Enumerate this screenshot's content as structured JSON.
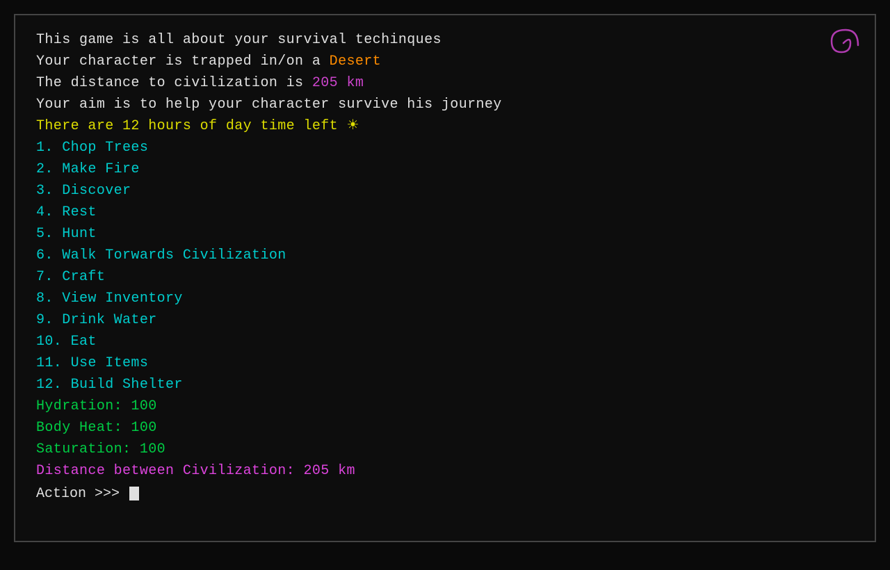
{
  "terminal": {
    "line1": "This game is all about your survival techinques",
    "line2_prefix": "Your character is trapped in/on a ",
    "line2_location": "Desert",
    "line3_prefix": "The distance to civilization is ",
    "line3_distance": "205 km",
    "line4": "Your aim is to help your character survive his journey",
    "line5_prefix": "There are 12 hours of day time left ",
    "sun_icon": "☀",
    "menu_items": [
      {
        "num": "1.",
        "label": "Chop Trees"
      },
      {
        "num": "2.",
        "label": "Make Fire"
      },
      {
        "num": "3.",
        "label": "Discover"
      },
      {
        "num": "4.",
        "label": "Rest"
      },
      {
        "num": "5.",
        "label": "Hunt"
      },
      {
        "num": "6.",
        "label": "Walk Torwards Civilization"
      },
      {
        "num": "7.",
        "label": "Craft"
      },
      {
        "num": "8.",
        "label": "View Inventory"
      },
      {
        "num": "9.",
        "label": "Drink Water"
      },
      {
        "num": "10.",
        "label": "Eat"
      },
      {
        "num": "11.",
        "label": "Use Items"
      },
      {
        "num": "12.",
        "label": "Build Shelter"
      }
    ],
    "stats": [
      {
        "label": "Hydration:",
        "value": "100"
      },
      {
        "label": "Body Heat:",
        "value": "100"
      },
      {
        "label": "Saturation:",
        "value": "100"
      }
    ],
    "distance_label": "Distance between Civilization:",
    "distance_value": "205 km",
    "action_prompt": "Action >>> "
  },
  "colors": {
    "white": "#e0e0e0",
    "orange": "#ff8c00",
    "purple": "#cc44cc",
    "yellow": "#dddd00",
    "cyan": "#00cccc",
    "green": "#00cc44",
    "magenta": "#dd44dd",
    "background": "#0d0d0d"
  }
}
